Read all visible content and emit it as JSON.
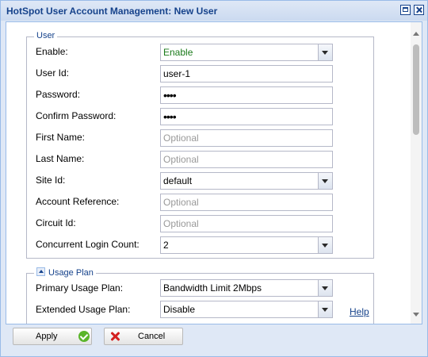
{
  "window": {
    "title": "HotSpot User Account Management: New User"
  },
  "user_section": {
    "legend": "User",
    "enable": {
      "label": "Enable:",
      "value": "Enable"
    },
    "user_id": {
      "label": "User Id:",
      "value": "user-1"
    },
    "password": {
      "label": "Password:",
      "value": "••••"
    },
    "confirm_password": {
      "label": "Confirm Password:",
      "value": "••••"
    },
    "first_name": {
      "label": "First Name:",
      "placeholder": "Optional"
    },
    "last_name": {
      "label": "Last Name:",
      "placeholder": "Optional"
    },
    "site_id": {
      "label": "Site Id:",
      "value": "default"
    },
    "account_reference": {
      "label": "Account Reference:",
      "placeholder": "Optional"
    },
    "circuit_id": {
      "label": "Circuit Id:",
      "placeholder": "Optional"
    },
    "concurrent_login_count": {
      "label": "Concurrent Login Count:",
      "value": "2"
    }
  },
  "usage_plan": {
    "legend": "Usage Plan",
    "primary": {
      "label": "Primary Usage Plan:",
      "value": "Bandwidth Limit 2Mbps"
    },
    "extended": {
      "label": "Extended Usage Plan:",
      "value": "Disable"
    },
    "help_link": "Help"
  },
  "footer": {
    "apply_label": "Apply",
    "cancel_label": "Cancel"
  },
  "icons": {
    "apply": "check-circle-icon",
    "cancel": "red-x-icon",
    "maximize": "maximize-icon",
    "close": "close-icon"
  }
}
